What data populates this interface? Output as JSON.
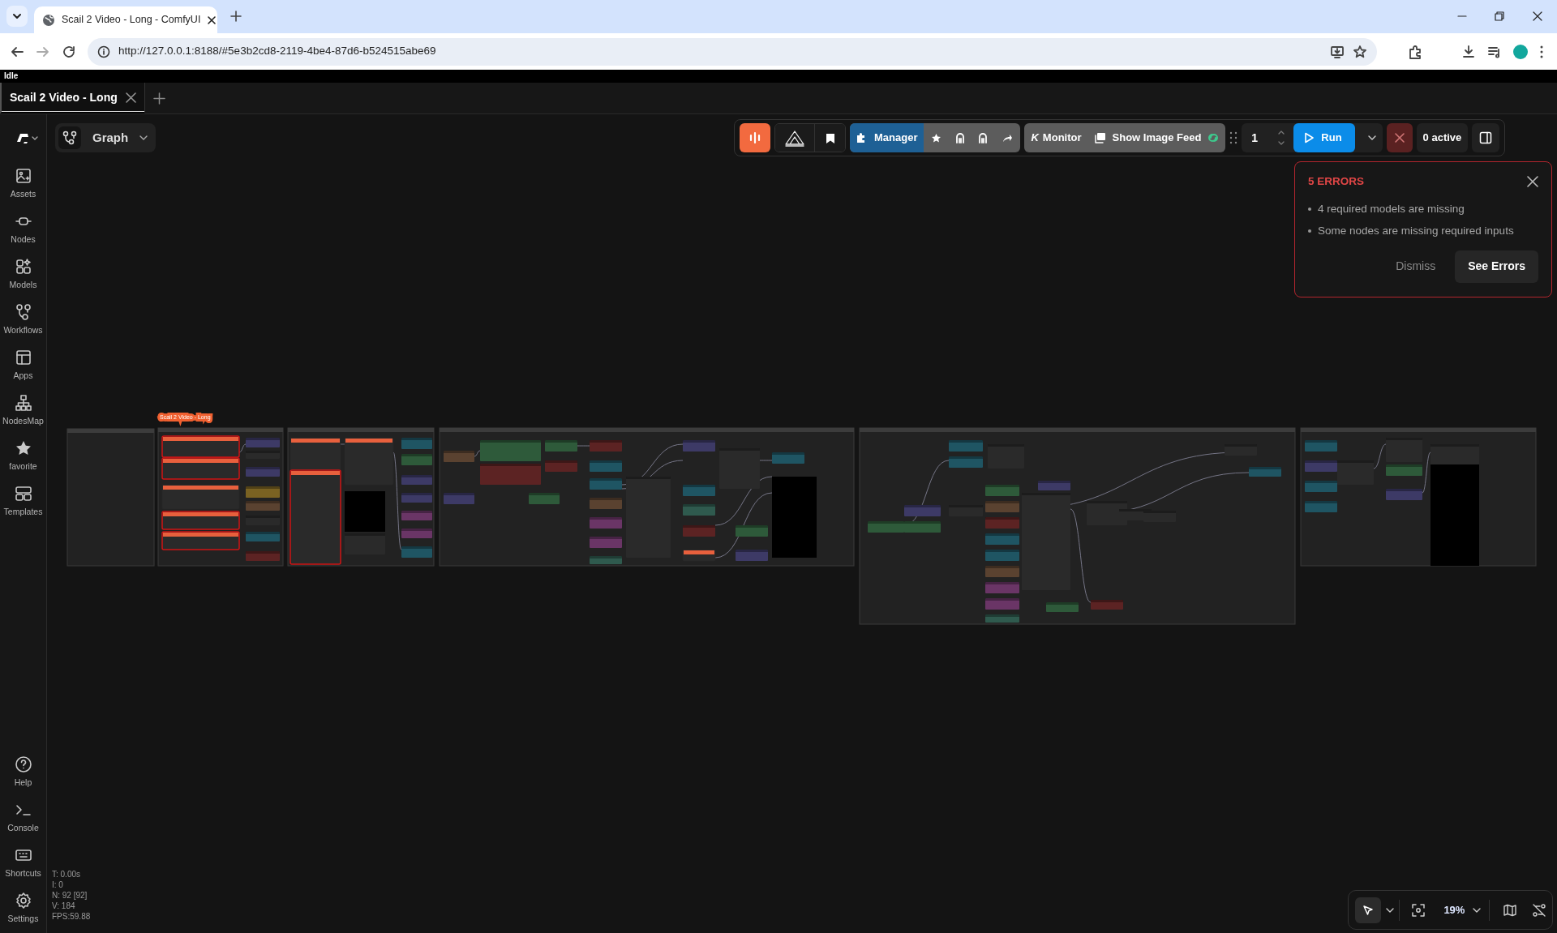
{
  "browser": {
    "tab_title": "Scail 2 Video - Long - ComfyUI",
    "url": "http://127.0.0.1:8188/#5e3b2cd8-2119-4be4-87d6-b524515abe69"
  },
  "status": "Idle",
  "workflow_tabs": [
    {
      "label": "Scail 2 Video - Long",
      "selected": true
    }
  ],
  "view_menu": {
    "label": "Graph"
  },
  "sidebar": {
    "items": [
      {
        "label": "Assets"
      },
      {
        "label": "Nodes"
      },
      {
        "label": "Models"
      },
      {
        "label": "Workflows"
      },
      {
        "label": "Apps"
      },
      {
        "label": "NodesMap"
      },
      {
        "label": "favorite"
      },
      {
        "label": "Templates"
      }
    ],
    "bottom_items": [
      {
        "label": "Help"
      },
      {
        "label": "Console"
      },
      {
        "label": "Shortcuts"
      },
      {
        "label": "Settings"
      }
    ]
  },
  "toolbar": {
    "manager": "Manager",
    "monitor_glyph": "K",
    "monitor": "Monitor",
    "image_feed": "Show Image Feed",
    "batch_count": "1",
    "run": "Run",
    "active": "0 active"
  },
  "errors": {
    "title": "5 ERRORS",
    "items": [
      "4 required models are missing",
      "Some nodes are missing required inputs"
    ],
    "dismiss": "Dismiss",
    "see_errors": "See Errors"
  },
  "canvas": {
    "subgraph_label": "Scail 2 Video - Long"
  },
  "stats": [
    "T: 0.00s",
    "I: 0",
    "N: 92 [92]",
    "V: 184",
    "FPS:59.88"
  ],
  "zoom": "19%"
}
